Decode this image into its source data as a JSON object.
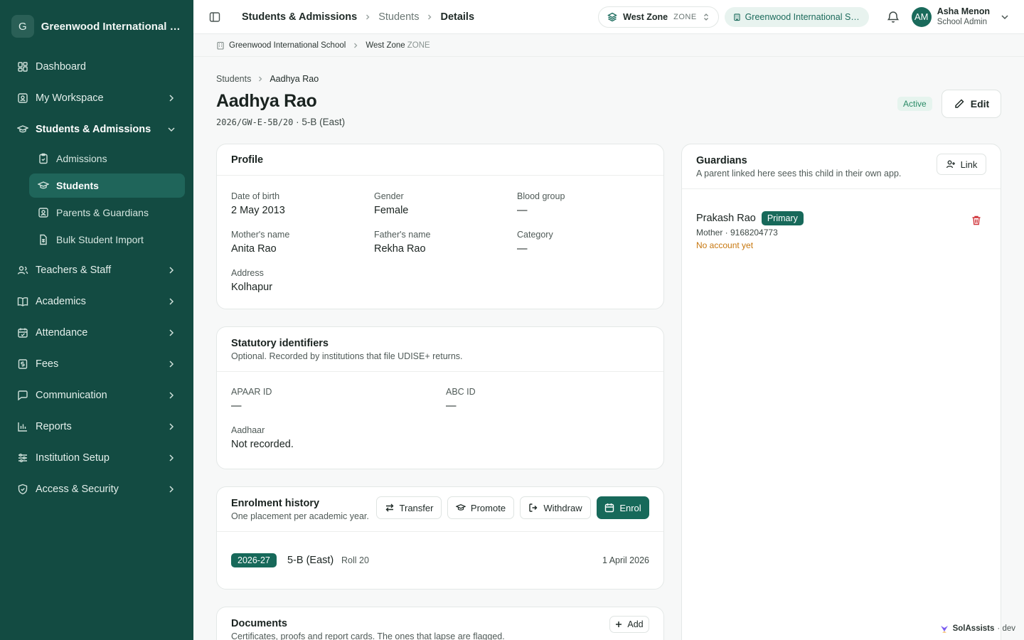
{
  "sidebar": {
    "org_initial": "G",
    "org_name": "Greenwood International School",
    "items": {
      "dashboard": "Dashboard",
      "workspace": "My Workspace",
      "students_admissions": "Students & Admissions",
      "teachers": "Teachers & Staff",
      "academics": "Academics",
      "attendance": "Attendance",
      "fees": "Fees",
      "communication": "Communication",
      "reports": "Reports",
      "institution": "Institution Setup",
      "access": "Access & Security"
    },
    "sub": {
      "admissions": "Admissions",
      "students": "Students",
      "parents": "Parents & Guardians",
      "bulk": "Bulk Student Import"
    }
  },
  "topbar": {
    "crumb1": "Students & Admissions",
    "crumb2": "Students",
    "crumb3": "Details",
    "zone_name": "West Zone",
    "zone_tag": "ZONE",
    "school": "Greenwood International School",
    "user_initials": "AM",
    "user_name": "Asha Menon",
    "user_role": "School Admin"
  },
  "subbar": {
    "school": "Greenwood International School",
    "zone": "West Zone",
    "zone_tag": "ZONE"
  },
  "page": {
    "crumb1": "Students",
    "crumb2": "Aadhya Rao",
    "title": "Aadhya Rao",
    "code": "2026/GW-E-5B/20",
    "meta": " · 5-B (East)",
    "status": "Active",
    "edit": "Edit"
  },
  "profile": {
    "title": "Profile",
    "dob_label": "Date of birth",
    "dob": "2 May 2013",
    "gender_label": "Gender",
    "gender": "Female",
    "blood_label": "Blood group",
    "blood": "—",
    "mother_label": "Mother's name",
    "mother": "Anita Rao",
    "father_label": "Father's name",
    "father": "Rekha Rao",
    "category_label": "Category",
    "category": "—",
    "address_label": "Address",
    "address": "Kolhapur"
  },
  "statutory": {
    "title": "Statutory identifiers",
    "subtitle": "Optional. Recorded by institutions that file UDISE+ returns.",
    "apaar_label": "APAAR ID",
    "apaar": "—",
    "abc_label": "ABC ID",
    "abc": "—",
    "aadhaar_label": "Aadhaar",
    "aadhaar": "Not recorded."
  },
  "enrolment": {
    "title": "Enrolment history",
    "subtitle": "One placement per academic year.",
    "transfer": "Transfer",
    "promote": "Promote",
    "withdraw": "Withdraw",
    "enrol": "Enrol",
    "year": "2026-27",
    "class": "5-B (East)",
    "roll": "Roll 20",
    "date": "1 April 2026"
  },
  "documents": {
    "title": "Documents",
    "subtitle": "Certificates, proofs and report cards. The ones that lapse are flagged.",
    "add": "Add"
  },
  "guardians": {
    "title": "Guardians",
    "subtitle": "A parent linked here sees this child in their own app.",
    "link": "Link",
    "name": "Prakash Rao",
    "badge": "Primary",
    "relation": "Mother · 9168204773",
    "account": "No account yet"
  },
  "brand": {
    "name": "SolAssists",
    "env": "· dev"
  },
  "colors": {
    "sidebar": "#134b42",
    "accent": "#17695a",
    "danger": "#d0343a",
    "warning": "#c7770e",
    "active_badge": "#2a8a66"
  }
}
